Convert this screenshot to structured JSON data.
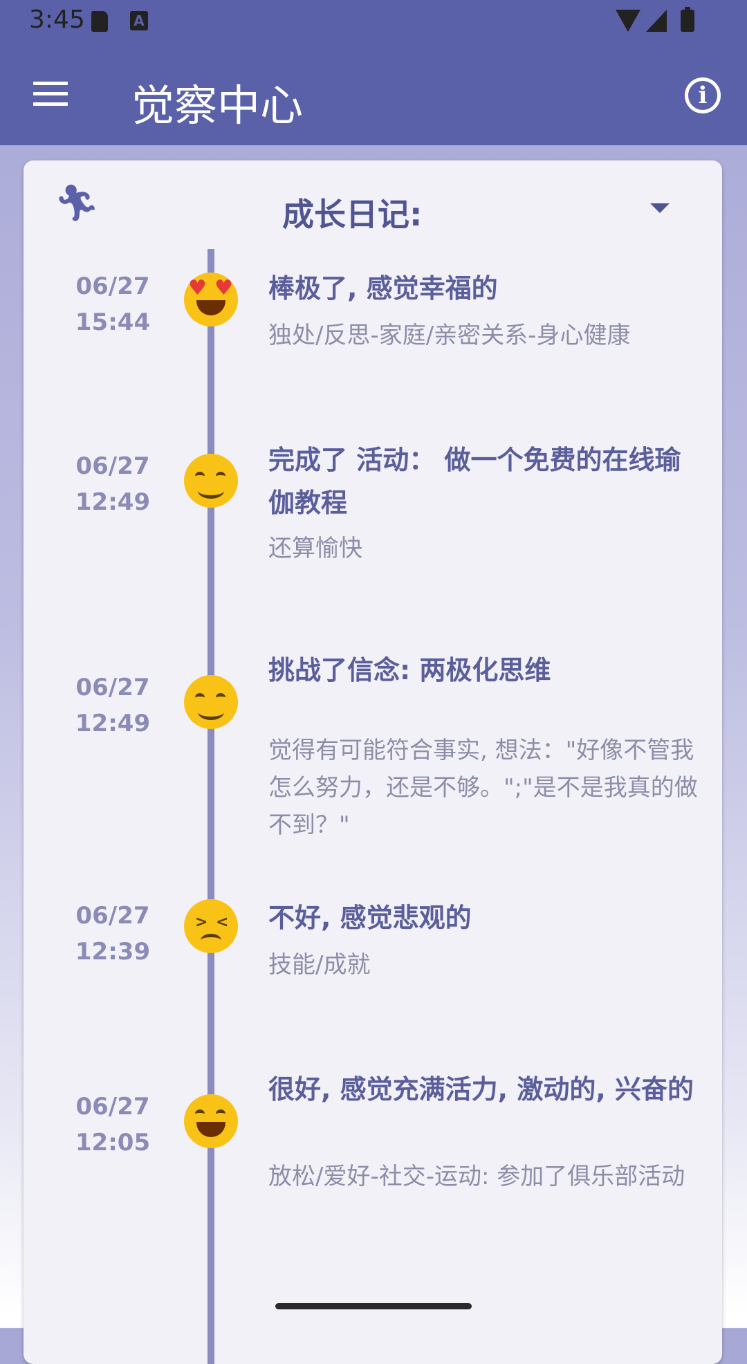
{
  "status_bar": {
    "time": "3:45",
    "a_badge": "A"
  },
  "app_bar": {
    "title": "觉察中心",
    "info_symbol": "i"
  },
  "card": {
    "header_title": "成长日记:"
  },
  "entries": [
    {
      "date": "06/27",
      "time": "15:44",
      "emoji": "heart-eyes-face-icon",
      "title": "棒极了, 感觉幸福的",
      "detail": "独处/反思-家庭/亲密关系-身心健康"
    },
    {
      "date": "06/27",
      "time": "12:49",
      "emoji": "smiling-face-icon",
      "title": "完成了 活动： 做一个免费的在线瑜伽教程",
      "detail": "还算愉快"
    },
    {
      "date": "06/27",
      "time": "12:49",
      "emoji": "smiling-face-icon",
      "title": "挑战了信念: 两极化思维",
      "detail": "觉得有可能符合事实, 想法：\"好像不管我怎么努力，还是不够。\";\"是不是我真的做不到？\""
    },
    {
      "date": "06/27",
      "time": "12:39",
      "emoji": "persevering-face-icon",
      "title": "不好, 感觉悲观的",
      "detail": "技能/成就"
    },
    {
      "date": "06/27",
      "time": "12:05",
      "emoji": "grinning-face-icon",
      "title": "很好, 感觉充满活力, 激动的, 兴奋的",
      "detail": "放松/爱好-社交-运动: 参加了俱乐部活动"
    }
  ]
}
